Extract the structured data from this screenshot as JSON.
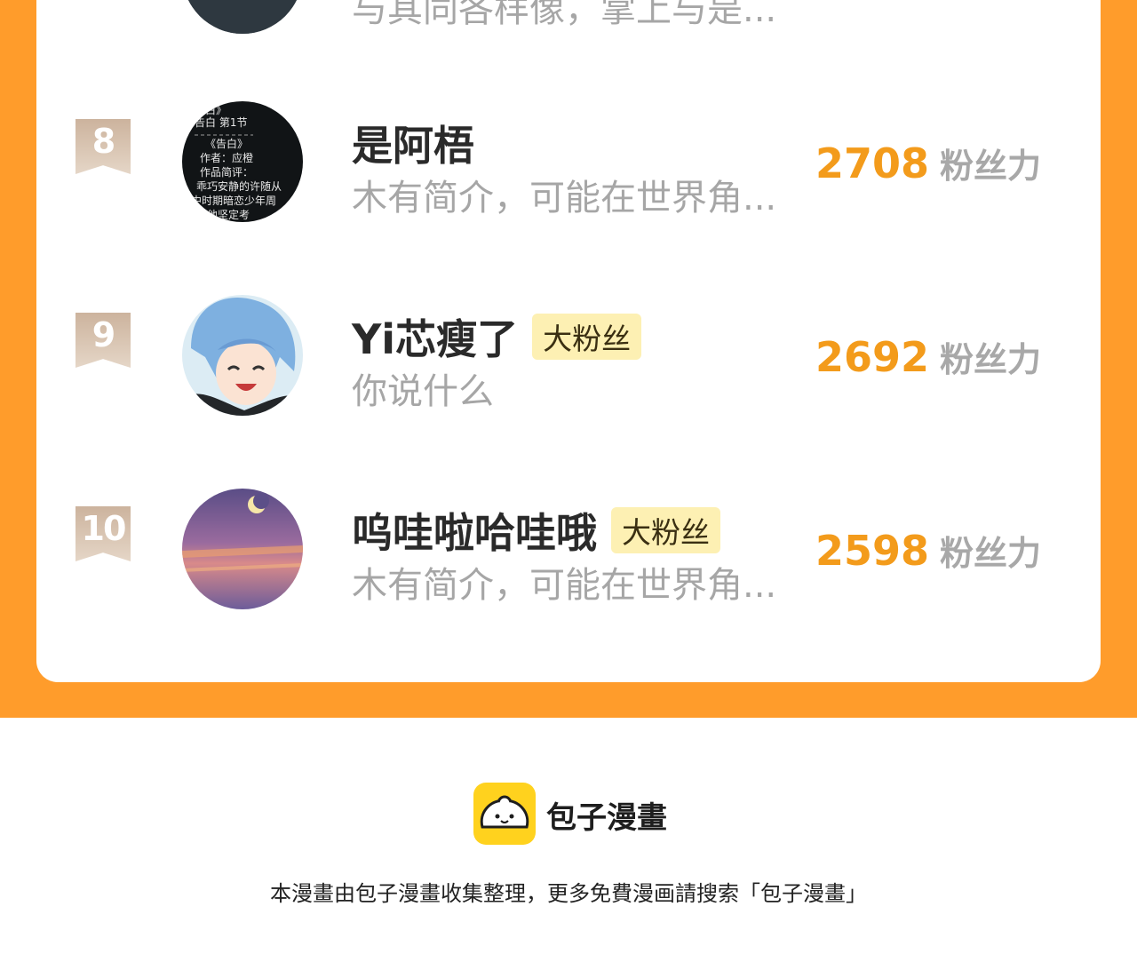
{
  "ranking": {
    "unit_label": "粉丝力",
    "rows": [
      {
        "rank": "",
        "name": "",
        "badge": "",
        "intro": "与其同各样像，掌上与是...",
        "score": ""
      },
      {
        "rank": "8",
        "name": "是阿梧",
        "badge": "",
        "intro": "木有简介，可能在世界角...",
        "score": "2708"
      },
      {
        "rank": "9",
        "name": "Yi芯瘦了",
        "badge": "大粉丝",
        "intro": "你说什么",
        "score": "2692"
      },
      {
        "rank": "10",
        "name": "呜哇啦哈哇哦",
        "badge": "大粉丝",
        "intro": "木有简介，可能在世界角...",
        "score": "2598"
      }
    ],
    "avatar_text": [
      "告白》",
      "告白 第1节",
      "《告白》",
      "作者：应橙",
      "作品简评：",
      "乖巧安静的许随从",
      "中时期暗恋少年周",
      "了他坚定考"
    ]
  },
  "footer": {
    "app_name": "包子漫畫",
    "note": "本漫畫由包子漫畫收集整理，更多免費漫画請搜索「包子漫畫」"
  },
  "colors": {
    "accent": "#ff9c2b",
    "score": "#f39b1b",
    "badge_bg": "#fdf0b3",
    "logo": "#ffd21e"
  }
}
